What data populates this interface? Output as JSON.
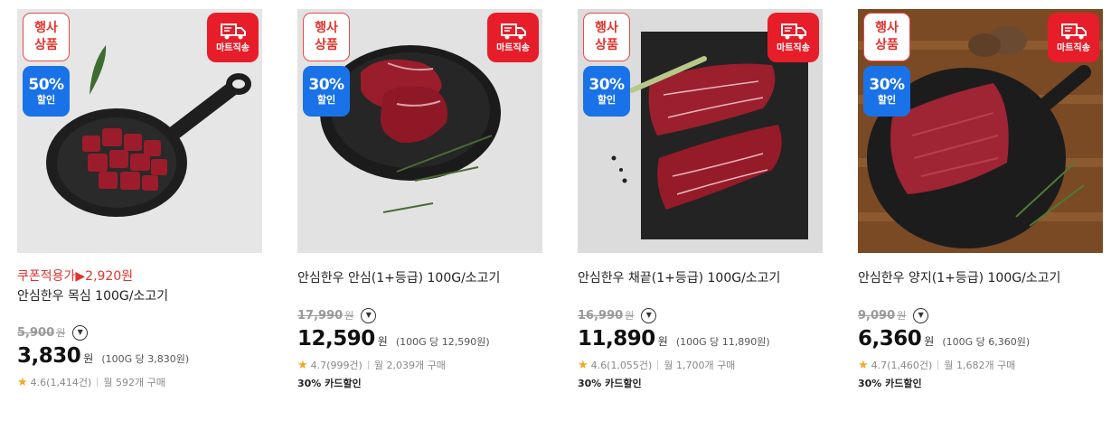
{
  "products": [
    {
      "event_badge": [
        "행사",
        "상품"
      ],
      "discount_badge": {
        "percent": "50%",
        "label": "할인"
      },
      "delivery_badge": "마트직송",
      "coupon_price": "쿠폰적용가▶2,920원",
      "name": "안심한우 목심 100G/소고기",
      "original_price": "5,900",
      "original_unit": "원",
      "price": "3,830",
      "price_unit": "원",
      "unit_price": "(100G 당 3,830원)",
      "rating": "4.6(1,414건)",
      "monthly_sales": "월 592개 구매",
      "card_sale": ""
    },
    {
      "event_badge": [
        "행사",
        "상품"
      ],
      "discount_badge": {
        "percent": "30%",
        "label": "할인"
      },
      "delivery_badge": "마트직송",
      "coupon_price": "",
      "name": "안심한우 안심(1+등급) 100G/소고기",
      "original_price": "17,990",
      "original_unit": "원",
      "price": "12,590",
      "price_unit": "원",
      "unit_price": "(100G 당 12,590원)",
      "rating": "4.7(999건)",
      "monthly_sales": "월 2,039개 구매",
      "card_sale": "30% 카드할인"
    },
    {
      "event_badge": [
        "행사",
        "상품"
      ],
      "discount_badge": {
        "percent": "30%",
        "label": "할인"
      },
      "delivery_badge": "마트직송",
      "coupon_price": "",
      "name": "안심한우 채끝(1+등급) 100G/소고기",
      "original_price": "16,990",
      "original_unit": "원",
      "price": "11,890",
      "price_unit": "원",
      "unit_price": "(100G 당 11,890원)",
      "rating": "4.6(1,055건)",
      "monthly_sales": "월 1,700개 구매",
      "card_sale": "30% 카드할인"
    },
    {
      "event_badge": [
        "행사",
        "상품"
      ],
      "discount_badge": {
        "percent": "30%",
        "label": "할인"
      },
      "delivery_badge": "마트직송",
      "coupon_price": "",
      "name": "안심한우 양지(1+등급) 100G/소고기",
      "original_price": "9,090",
      "original_unit": "원",
      "price": "6,360",
      "price_unit": "원",
      "unit_price": "(100G 당 6,360원)",
      "rating": "4.7(1,460건)",
      "monthly_sales": "월 1,682개 구매",
      "card_sale": "30% 카드할인"
    }
  ],
  "icons": {
    "star": "star-icon",
    "info": "chevron-down-circle-icon",
    "delivery": "truck-icon"
  },
  "colors": {
    "event_badge_border": "#e64a4a",
    "discount_badge_bg": "#1a72e8",
    "delivery_badge_bg": "#e81d2a",
    "coupon_text": "#e3322c",
    "star": "#f5a623"
  }
}
